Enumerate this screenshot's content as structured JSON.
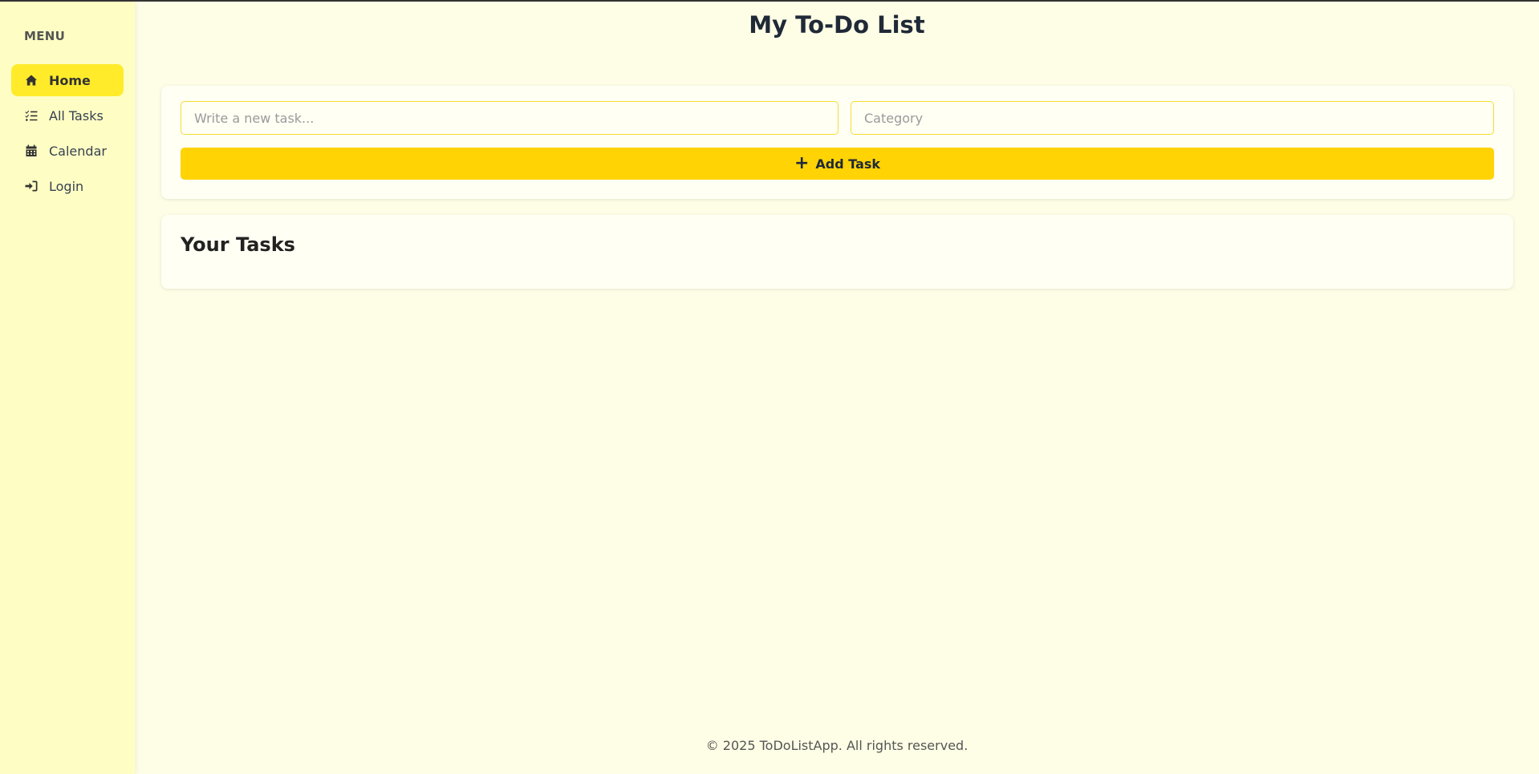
{
  "sidebar": {
    "heading": "MENU",
    "items": [
      {
        "label": "Home",
        "icon": "home-icon",
        "active": true
      },
      {
        "label": "All Tasks",
        "icon": "list-check-icon",
        "active": false
      },
      {
        "label": "Calendar",
        "icon": "calendar-icon",
        "active": false
      },
      {
        "label": "Login",
        "icon": "sign-in-icon",
        "active": false
      }
    ]
  },
  "header": {
    "title": "My To-Do List"
  },
  "form": {
    "task_placeholder": "Write a new task...",
    "task_value": "",
    "category_placeholder": "Category",
    "category_value": "",
    "add_button_label": "Add Task",
    "add_button_icon": "plus-icon"
  },
  "tasks": {
    "heading": "Your Tasks",
    "items": []
  },
  "footer": {
    "text": "© 2025 ToDoListApp. All rights reserved."
  },
  "colors": {
    "background": "#fefee6",
    "sidebar": "#fefec4",
    "active_nav": "#ffeb2a",
    "accent": "#ffd304",
    "input_border": "#f5dd35"
  }
}
